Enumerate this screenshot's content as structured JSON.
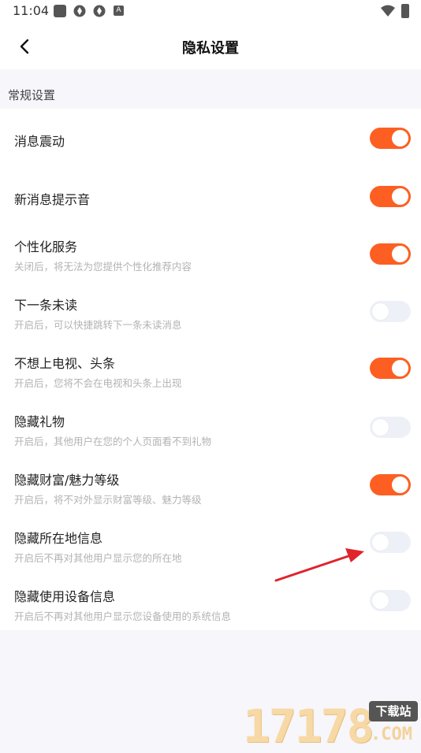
{
  "status_bar": {
    "time": "11:04",
    "notification_a": "A"
  },
  "header": {
    "title": "隐私设置"
  },
  "section": {
    "title": "常规设置"
  },
  "settings": [
    {
      "label": "消息震动",
      "desc": "",
      "enabled": true
    },
    {
      "label": "新消息提示音",
      "desc": "",
      "enabled": true
    },
    {
      "label": "个性化服务",
      "desc": "关闭后，将无法为您提供个性化推荐内容",
      "enabled": true
    },
    {
      "label": "下一条未读",
      "desc": "开启后，可以快捷跳转下一条未读消息",
      "enabled": false
    },
    {
      "label": "不想上电视、头条",
      "desc": "开启后，您将不会在电视和头条上出现",
      "enabled": true
    },
    {
      "label": "隐藏礼物",
      "desc": "开启后，其他用户在您的个人页面看不到礼物",
      "enabled": false
    },
    {
      "label": "隐藏财富/魅力等级",
      "desc": "开启后，将不对外显示财富等级、魅力等级",
      "enabled": true
    },
    {
      "label": "隐藏所在地信息",
      "desc": "开启后不再对其他用户显示您的所在地",
      "enabled": false
    },
    {
      "label": "隐藏使用设备信息",
      "desc": "开启后不再对其他用户显示您设备使用的系统信息",
      "enabled": false
    }
  ],
  "colors": {
    "toggle_on": "#fd5f22",
    "toggle_off": "#eef0f8",
    "annotation_arrow": "#e0242b"
  },
  "watermark": {
    "digits": "17178",
    "badge": "下载站",
    "domain": ".COM"
  }
}
